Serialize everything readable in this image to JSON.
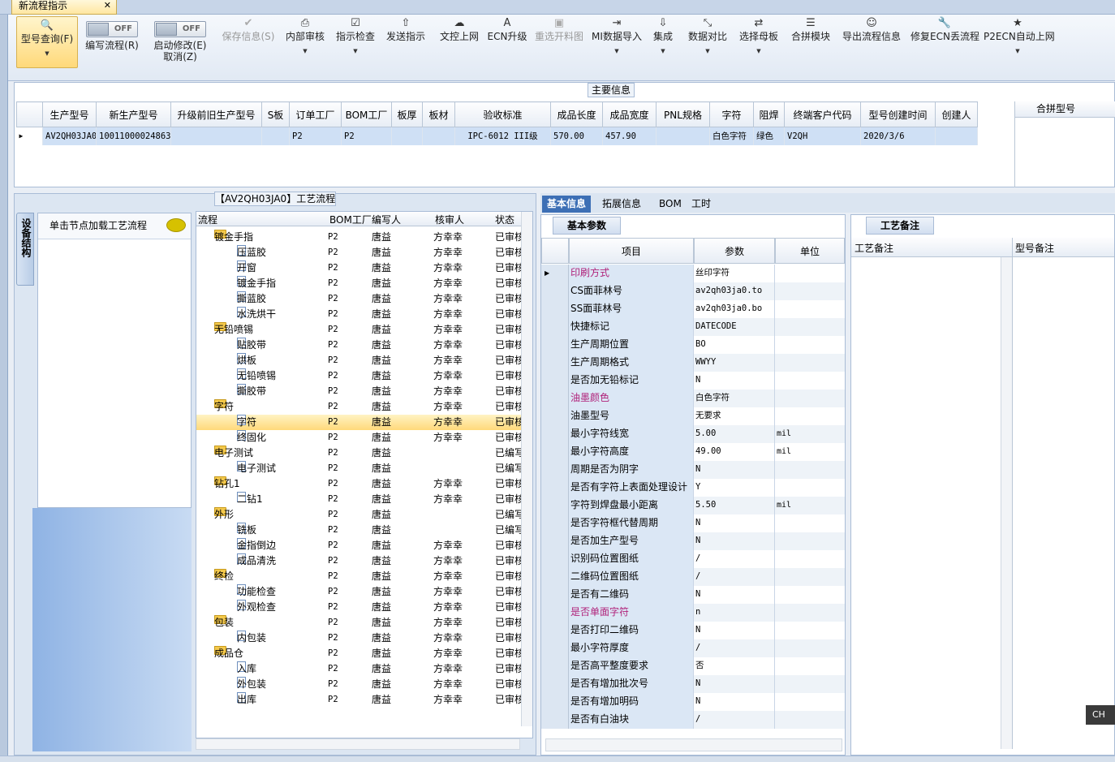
{
  "window": {
    "tab_title": "新流程指示"
  },
  "ribbon": [
    {
      "name": "query-button",
      "label": "型号查询(F)",
      "icon": "search-icon",
      "glyph": "🔍",
      "dropdown": true,
      "active": true
    },
    {
      "name": "edit-flow-toggle",
      "label": "编写流程(R)",
      "toggle": "OFF"
    },
    {
      "name": "start-edit-toggle",
      "label": "启动修改(E)",
      "label2": "取消(Z)",
      "toggle": "OFF"
    },
    {
      "name": "save-info-button",
      "label": "保存信息(S)",
      "icon": "check-icon",
      "glyph": "✔",
      "disabled": true
    },
    {
      "name": "internal-review-button",
      "label": "内部审核",
      "icon": "printer-icon",
      "glyph": "⎙",
      "dropdown": true
    },
    {
      "name": "instruction-check-button",
      "label": "指示检查",
      "icon": "checkbox-icon",
      "glyph": "☑",
      "dropdown": true
    },
    {
      "name": "send-instruction-button",
      "label": "发送指示",
      "icon": "upload-icon",
      "glyph": "⇧"
    },
    {
      "name": "file-upload-button",
      "label": "文控上网",
      "icon": "cloud-upload-icon",
      "glyph": "☁"
    },
    {
      "name": "ecn-upgrade-button",
      "label": "ECN升级",
      "icon": "font-a-icon",
      "glyph": "A"
    },
    {
      "name": "reselect-image-button",
      "label": "重选开料图",
      "icon": "image-icon",
      "glyph": "▣",
      "disabled": true
    },
    {
      "name": "mi-import-button",
      "label": "MI数据导入",
      "icon": "import-icon",
      "glyph": "⇥",
      "dropdown": true
    },
    {
      "name": "integrate-button",
      "label": "集成",
      "icon": "download-icon",
      "glyph": "⇩",
      "dropdown": true
    },
    {
      "name": "data-compare-button",
      "label": "数据对比",
      "icon": "compress-icon",
      "glyph": "⤡",
      "dropdown": true
    },
    {
      "name": "select-master-button",
      "label": "选择母板",
      "icon": "shuffle-icon",
      "glyph": "⇄",
      "dropdown": true
    },
    {
      "name": "merge-module-button",
      "label": "合拼模块",
      "icon": "list-icon",
      "glyph": "☰"
    },
    {
      "name": "export-flow-button",
      "label": "导出流程信息",
      "icon": "smiley-icon",
      "glyph": "☺"
    },
    {
      "name": "fix-ecn-button",
      "label": "修复ECN丢流程",
      "icon": "wrench-icon",
      "glyph": "🔧"
    },
    {
      "name": "p2ecn-upload-button",
      "label": "P2ECN自动上网",
      "icon": "star-icon",
      "glyph": "★",
      "dropdown": true
    }
  ],
  "main_info": {
    "title": "主要信息",
    "columns": [
      "生产型号",
      "新生产型号",
      "升级前旧生产型号",
      "S板",
      "订单工厂",
      "BOM工厂",
      "板厚",
      "板材",
      "验收标准",
      "成品长度",
      "成品宽度",
      "PNL规格",
      "字符",
      "阻焊",
      "终端客户代码",
      "型号创建时间",
      "创建人"
    ],
    "row": [
      "AV2QH03JA0",
      "10011000024863",
      "",
      "",
      "P2",
      "P2",
      "",
      "",
      "IPC-6012 III级",
      "570.00",
      "457.90",
      "",
      "白色字符",
      "绿色",
      "V2QH",
      "2020/3/6",
      ""
    ],
    "merge_header": "合拼型号"
  },
  "flow": {
    "title": "【AV2QH03JA0】工艺流程",
    "side_tab": "设备结构",
    "node_hint": "单击节点加载工艺流程",
    "columns": [
      "流程",
      "BOM工厂",
      "编写人",
      "核审人",
      "状态"
    ],
    "rows": [
      {
        "name": "镀金手指",
        "level": 0,
        "bom": "P2",
        "writer": "唐益",
        "reviewer": "方幸幸",
        "status": "已审核"
      },
      {
        "name": "压蓝胶",
        "level": 1,
        "bom": "P2",
        "writer": "唐益",
        "reviewer": "方幸幸",
        "status": "已审核"
      },
      {
        "name": "开窗",
        "level": 1,
        "bom": "P2",
        "writer": "唐益",
        "reviewer": "方幸幸",
        "status": "已审核"
      },
      {
        "name": "镀金手指",
        "level": 1,
        "bom": "P2",
        "writer": "唐益",
        "reviewer": "方幸幸",
        "status": "已审核"
      },
      {
        "name": "撕蓝胶",
        "level": 1,
        "bom": "P2",
        "writer": "唐益",
        "reviewer": "方幸幸",
        "status": "已审核"
      },
      {
        "name": "水洗烘干",
        "level": 1,
        "bom": "P2",
        "writer": "唐益",
        "reviewer": "方幸幸",
        "status": "已审核"
      },
      {
        "name": "无铅喷锡",
        "level": 0,
        "bom": "P2",
        "writer": "唐益",
        "reviewer": "方幸幸",
        "status": "已审核"
      },
      {
        "name": "贴胶带",
        "level": 1,
        "bom": "P2",
        "writer": "唐益",
        "reviewer": "方幸幸",
        "status": "已审核"
      },
      {
        "name": "烘板",
        "level": 1,
        "bom": "P2",
        "writer": "唐益",
        "reviewer": "方幸幸",
        "status": "已审核"
      },
      {
        "name": "无铅喷锡",
        "level": 1,
        "bom": "P2",
        "writer": "唐益",
        "reviewer": "方幸幸",
        "status": "已审核"
      },
      {
        "name": "撕胶带",
        "level": 1,
        "bom": "P2",
        "writer": "唐益",
        "reviewer": "方幸幸",
        "status": "已审核"
      },
      {
        "name": "字符",
        "level": 0,
        "bom": "P2",
        "writer": "唐益",
        "reviewer": "方幸幸",
        "status": "已审核"
      },
      {
        "name": "字符",
        "level": 1,
        "bom": "P2",
        "writer": "唐益",
        "reviewer": "方幸幸",
        "status": "已审核",
        "selected": true
      },
      {
        "name": "终固化",
        "level": 1,
        "bom": "P2",
        "writer": "唐益",
        "reviewer": "方幸幸",
        "status": "已审核"
      },
      {
        "name": "电子测试",
        "level": 0,
        "bom": "P2",
        "writer": "唐益",
        "reviewer": "",
        "status": "已编写"
      },
      {
        "name": "电子测试",
        "level": 1,
        "bom": "P2",
        "writer": "唐益",
        "reviewer": "",
        "status": "已编写"
      },
      {
        "name": "钻孔1",
        "level": 0,
        "bom": "P2",
        "writer": "唐益",
        "reviewer": "方幸幸",
        "status": "已审核"
      },
      {
        "name": "二钻1",
        "level": 1,
        "bom": "P2",
        "writer": "唐益",
        "reviewer": "方幸幸",
        "status": "已审核"
      },
      {
        "name": "外形",
        "level": 0,
        "bom": "P2",
        "writer": "唐益",
        "reviewer": "",
        "status": "已编写"
      },
      {
        "name": "铣板",
        "level": 1,
        "bom": "P2",
        "writer": "唐益",
        "reviewer": "",
        "status": "已编写"
      },
      {
        "name": "金指倒边",
        "level": 1,
        "bom": "P2",
        "writer": "唐益",
        "reviewer": "方幸幸",
        "status": "已审核"
      },
      {
        "name": "成品清洗",
        "level": 1,
        "bom": "P2",
        "writer": "唐益",
        "reviewer": "方幸幸",
        "status": "已审核"
      },
      {
        "name": "终检",
        "level": 0,
        "bom": "P2",
        "writer": "唐益",
        "reviewer": "方幸幸",
        "status": "已审核"
      },
      {
        "name": "功能检查",
        "level": 1,
        "bom": "P2",
        "writer": "唐益",
        "reviewer": "方幸幸",
        "status": "已审核"
      },
      {
        "name": "外观检查",
        "level": 1,
        "bom": "P2",
        "writer": "唐益",
        "reviewer": "方幸幸",
        "status": "已审核"
      },
      {
        "name": "包装",
        "level": 0,
        "bom": "P2",
        "writer": "唐益",
        "reviewer": "方幸幸",
        "status": "已审核"
      },
      {
        "name": "内包装",
        "level": 1,
        "bom": "P2",
        "writer": "唐益",
        "reviewer": "方幸幸",
        "status": "已审核"
      },
      {
        "name": "成品仓",
        "level": 0,
        "bom": "P2",
        "writer": "唐益",
        "reviewer": "方幸幸",
        "status": "已审核"
      },
      {
        "name": "入库",
        "level": 1,
        "bom": "P2",
        "writer": "唐益",
        "reviewer": "方幸幸",
        "status": "已审核"
      },
      {
        "name": "外包装",
        "level": 1,
        "bom": "P2",
        "writer": "唐益",
        "reviewer": "方幸幸",
        "status": "已审核"
      },
      {
        "name": "出库",
        "level": 1,
        "bom": "P2",
        "writer": "唐益",
        "reviewer": "方幸幸",
        "status": "已审核"
      }
    ]
  },
  "detail": {
    "tabs": [
      "基本信息",
      "拓展信息",
      "BOM",
      "工时"
    ],
    "active_tab": 0,
    "params_title": "基本参数",
    "columns": [
      "项目",
      "参数",
      "单位"
    ],
    "rows": [
      {
        "item": "印刷方式",
        "value": "丝印字符",
        "unit": "",
        "pink": true,
        "current": true
      },
      {
        "item": "CS面菲林号",
        "value": "av2qh03ja0.to",
        "unit": ""
      },
      {
        "item": "SS面菲林号",
        "value": "av2qh03ja0.bo",
        "unit": ""
      },
      {
        "item": "快捷标记",
        "value": "DATECODE",
        "unit": ""
      },
      {
        "item": "生产周期位置",
        "value": "BO",
        "unit": ""
      },
      {
        "item": "生产周期格式",
        "value": "WWYY",
        "unit": ""
      },
      {
        "item": "是否加无铅标记",
        "value": "N",
        "unit": ""
      },
      {
        "item": "油墨颜色",
        "value": "白色字符",
        "unit": "",
        "pink": true
      },
      {
        "item": "油墨型号",
        "value": "无要求",
        "unit": ""
      },
      {
        "item": "最小字符线宽",
        "value": "5.00",
        "unit": "mil"
      },
      {
        "item": "最小字符高度",
        "value": "49.00",
        "unit": "mil"
      },
      {
        "item": "周期是否为阴字",
        "value": "N",
        "unit": ""
      },
      {
        "item": "是否有字符上表面处理设计",
        "value": "Y",
        "unit": ""
      },
      {
        "item": "字符到焊盘最小距离",
        "value": "5.50",
        "unit": "mil"
      },
      {
        "item": "是否字符框代替周期",
        "value": "N",
        "unit": ""
      },
      {
        "item": "是否加生产型号",
        "value": "N",
        "unit": ""
      },
      {
        "item": "识别码位置图纸",
        "value": "/",
        "unit": ""
      },
      {
        "item": "二维码位置图纸",
        "value": "/",
        "unit": ""
      },
      {
        "item": "是否有二维码",
        "value": "N",
        "unit": ""
      },
      {
        "item": "是否单面字符",
        "value": "n",
        "unit": "",
        "pink": true
      },
      {
        "item": "是否打印二维码",
        "value": "N",
        "unit": ""
      },
      {
        "item": "最小字符厚度",
        "value": "/",
        "unit": ""
      },
      {
        "item": "是否高平整度要求",
        "value": "否",
        "unit": ""
      },
      {
        "item": "是否有增加批次号",
        "value": "N",
        "unit": ""
      },
      {
        "item": "是否有增加明码",
        "value": "N",
        "unit": ""
      },
      {
        "item": "是否有白油块",
        "value": "/",
        "unit": ""
      }
    ],
    "remarks_title": "工艺备注",
    "remark_cols": [
      "工艺备注",
      "型号备注"
    ]
  },
  "ime": "CH",
  "colors": {
    "accent": "#3d6fb5",
    "selected": "#ffd97a",
    "pink": "#b0227a"
  }
}
